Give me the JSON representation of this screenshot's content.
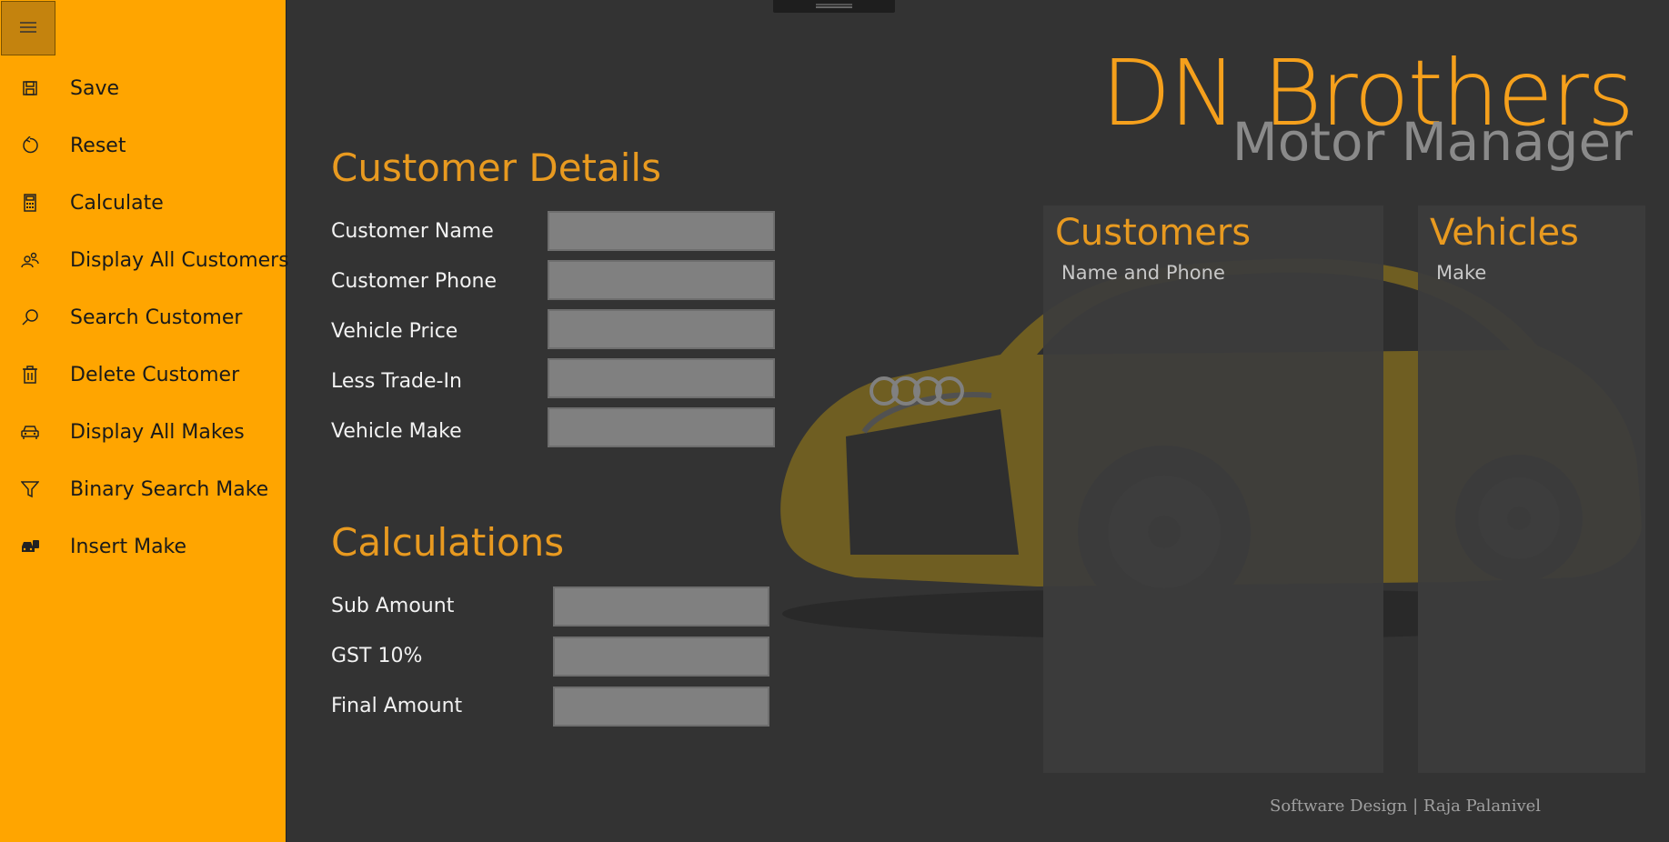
{
  "colors": {
    "accent": "#FFA500",
    "heading": "#E89A20",
    "background": "#333333",
    "input": "#808080"
  },
  "nav": {
    "menu_icon": "hamburger-icon",
    "items": [
      {
        "label": "Save",
        "icon": "save-icon"
      },
      {
        "label": "Reset",
        "icon": "reset-icon"
      },
      {
        "label": "Calculate",
        "icon": "calculator-icon"
      },
      {
        "label": "Display All Customers",
        "icon": "people-icon"
      },
      {
        "label": "Search Customer",
        "icon": "search-icon"
      },
      {
        "label": "Delete Customer",
        "icon": "trash-icon"
      },
      {
        "label": "Display All Makes",
        "icon": "car-icon"
      },
      {
        "label": "Binary Search Make",
        "icon": "filter-icon"
      },
      {
        "label": "Insert Make",
        "icon": "car-add-icon"
      }
    ]
  },
  "brand": {
    "title": "DN Brothers",
    "subtitle": "Motor Manager"
  },
  "customer_details": {
    "heading": "Customer Details",
    "fields": [
      {
        "label": "Customer Name",
        "value": ""
      },
      {
        "label": "Customer Phone",
        "value": ""
      },
      {
        "label": "Vehicle Price",
        "value": ""
      },
      {
        "label": "Less Trade-In",
        "value": ""
      },
      {
        "label": "Vehicle Make",
        "value": ""
      }
    ]
  },
  "calculations": {
    "heading": "Calculations",
    "fields": [
      {
        "label": "Sub Amount",
        "value": ""
      },
      {
        "label": "GST 10%",
        "value": ""
      },
      {
        "label": "Final Amount",
        "value": ""
      }
    ]
  },
  "customers_panel": {
    "title": "Customers",
    "subtitle": "Name and Phone"
  },
  "vehicles_panel": {
    "title": "Vehicles",
    "subtitle": "Make"
  },
  "footer": {
    "text": "Software Design | Raja Palanivel"
  }
}
